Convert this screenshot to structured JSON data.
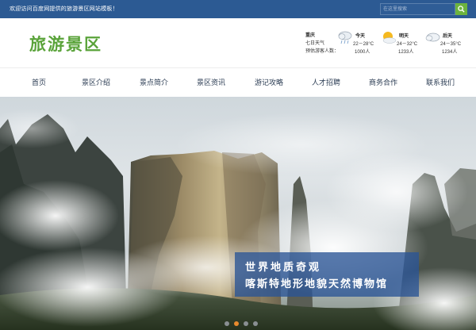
{
  "topbar": {
    "welcome": "欢迎访问百度网提供的旅游景区网站模板！",
    "search_placeholder": "在这里搜索"
  },
  "header": {
    "logo": "旅游景区"
  },
  "weather": {
    "city": "重庆",
    "label": "七日天气",
    "visitors_label": "预估游客人数：",
    "days": [
      {
        "name": "今天",
        "temp": "22－28°C",
        "count": "1000人",
        "icon": "cloud-rain-icon"
      },
      {
        "name": "明天",
        "temp": "24－32°C",
        "count": "1233人",
        "icon": "sun-cloud-icon"
      },
      {
        "name": "后天",
        "temp": "24－35°C",
        "count": "1234人",
        "icon": "cloud-icon"
      }
    ]
  },
  "nav": {
    "items": [
      "首页",
      "景区介绍",
      "景点简介",
      "景区资讯",
      "游记攻略",
      "人才招聘",
      "商务合作",
      "联系我们"
    ]
  },
  "hero": {
    "line1": "世界地质奇观",
    "line2": "喀斯特地形地貌天然博物馆",
    "slides": 4,
    "active_slide": 2
  },
  "colors": {
    "topbar": "#2c5a93",
    "logo": "#5aa33a",
    "search_button": "#6cb33e",
    "active_dot": "#e88a2e"
  }
}
